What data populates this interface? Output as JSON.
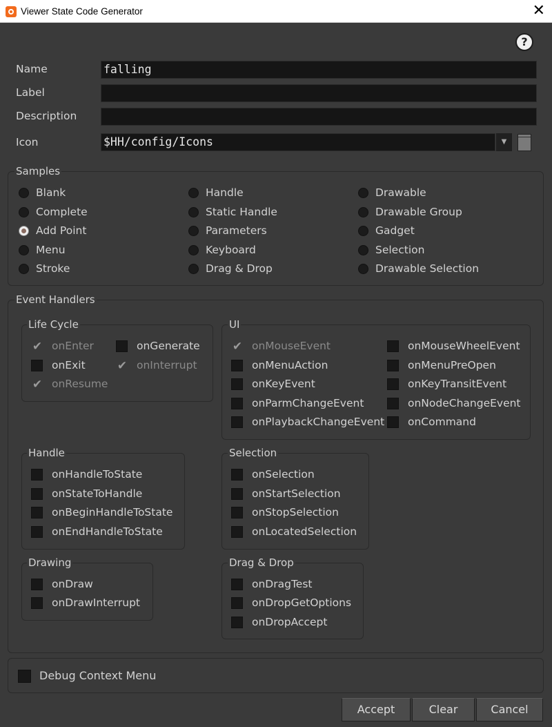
{
  "window": {
    "title": "Viewer State Code Generator",
    "close_glyph": "✕",
    "help_glyph": "?"
  },
  "fields": {
    "name_label": "Name",
    "name_value": "falling",
    "label_label": "Label",
    "label_value": "",
    "description_label": "Description",
    "description_value": "",
    "icon_label": "Icon",
    "icon_value": "$HH/config/Icons"
  },
  "samples": {
    "title": "Samples",
    "selected": "Add Point",
    "options": [
      "Blank",
      "Complete",
      "Add Point",
      "Menu",
      "Stroke",
      "Handle",
      "Static Handle",
      "Parameters",
      "Keyboard",
      "Drag & Drop",
      "Drawable",
      "Drawable Group",
      "Gadget",
      "Selection",
      "Drawable Selection"
    ]
  },
  "event_handlers": {
    "title": "Event Handlers",
    "life_cycle": {
      "title": "Life Cycle",
      "items": [
        {
          "label": "onEnter",
          "state": "checked-disabled"
        },
        {
          "label": "onGenerate",
          "state": "unchecked"
        },
        {
          "label": "onExit",
          "state": "unchecked"
        },
        {
          "label": "onInterrupt",
          "state": "checked-disabled"
        },
        {
          "label": "onResume",
          "state": "checked-disabled"
        }
      ]
    },
    "ui": {
      "title": "UI",
      "items": [
        {
          "label": "onMouseEvent",
          "state": "checked-disabled"
        },
        {
          "label": "onMouseWheelEvent",
          "state": "unchecked"
        },
        {
          "label": "onMenuAction",
          "state": "unchecked"
        },
        {
          "label": "onMenuPreOpen",
          "state": "unchecked"
        },
        {
          "label": "onKeyEvent",
          "state": "unchecked"
        },
        {
          "label": "onKeyTransitEvent",
          "state": "unchecked"
        },
        {
          "label": "onParmChangeEvent",
          "state": "unchecked"
        },
        {
          "label": "onNodeChangeEvent",
          "state": "unchecked"
        },
        {
          "label": "onPlaybackChangeEvent",
          "state": "unchecked"
        },
        {
          "label": "onCommand",
          "state": "unchecked"
        }
      ]
    },
    "handle": {
      "title": "Handle",
      "items": [
        "onHandleToState",
        "onStateToHandle",
        "onBeginHandleToState",
        "onEndHandleToState"
      ]
    },
    "selection": {
      "title": "Selection",
      "items": [
        "onSelection",
        "onStartSelection",
        "onStopSelection",
        "onLocatedSelection"
      ]
    },
    "drawing": {
      "title": "Drawing",
      "items": [
        "onDraw",
        "onDrawInterrupt"
      ]
    },
    "drag_drop": {
      "title": "Drag & Drop",
      "items": [
        "onDragTest",
        "onDropGetOptions",
        "onDropAccept"
      ]
    }
  },
  "debug": {
    "label": "Debug Context Menu",
    "checked": false
  },
  "buttons": {
    "accept": "Accept",
    "clear": "Clear",
    "cancel": "Cancel"
  },
  "colors": {
    "background": "#3a3a3a",
    "field_bg": "#151515",
    "titlebar": "#ffffff",
    "app_icon": "#f26b1d"
  }
}
